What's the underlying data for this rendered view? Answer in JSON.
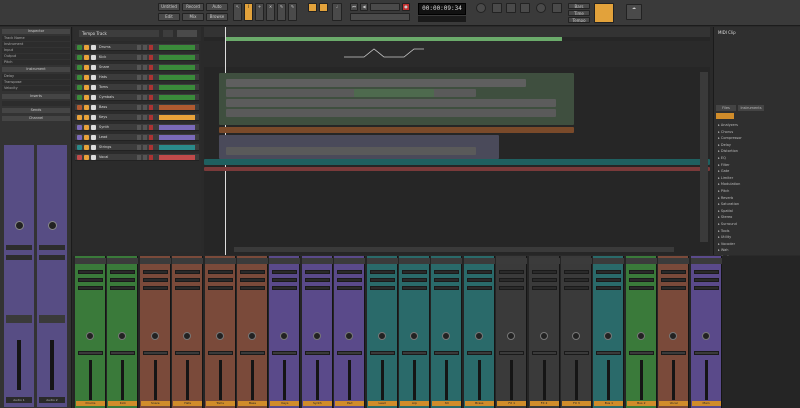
{
  "toolbar": {
    "left_buttons": [
      "Untitled",
      "Record",
      "Auto",
      "Edit",
      "Mix",
      "Browse"
    ],
    "time": "00:00:09:34",
    "right_labels": [
      "Bars",
      "Time",
      "Tempo"
    ]
  },
  "inspector": {
    "title": "Inspector",
    "rows": [
      "Track Name",
      "Instrument",
      "Input",
      "Output",
      "Pitch",
      "Delay",
      "Transpose",
      "Velocity"
    ],
    "sections": [
      "Instrument",
      "Inserts",
      "Sends",
      "Channel"
    ],
    "strips": [
      "Audio 1",
      "Audio 2"
    ]
  },
  "tracklist": {
    "header": "Tempo Track",
    "tracks": [
      {
        "name": "Drums",
        "color": "#3a8a3a"
      },
      {
        "name": "Kick",
        "color": "#3a8a3a"
      },
      {
        "name": "Snare",
        "color": "#3a8a3a"
      },
      {
        "name": "Hats",
        "color": "#3a8a3a"
      },
      {
        "name": "Toms",
        "color": "#3a8a3a"
      },
      {
        "name": "Cymbals",
        "color": "#3a8a3a"
      },
      {
        "name": "Bass",
        "color": "#b05a30"
      },
      {
        "name": "Keys",
        "color": "#e8a23a"
      },
      {
        "name": "Synth",
        "color": "#7a6ab8"
      },
      {
        "name": "Lead",
        "color": "#7a6ab8"
      },
      {
        "name": "Strings",
        "color": "#2a8a8a"
      },
      {
        "name": "Vocal",
        "color": "#c04a4a"
      }
    ]
  },
  "browser": {
    "title": "MIDI Clip",
    "tabs": [
      "Files",
      "Instruments"
    ],
    "items": [
      "Analyzers",
      "Chorus",
      "Compressor",
      "Delay",
      "Distortion",
      "EQ",
      "Filter",
      "Gate",
      "Limiter",
      "Modulation",
      "Pitch",
      "Reverb",
      "Saturation",
      "Spatial",
      "Stereo",
      "Surround",
      "Tools",
      "Utility",
      "Vocoder",
      "Wah",
      "Audio"
    ]
  },
  "mixer": {
    "strips": [
      {
        "name": "Drums",
        "color": "#3a7a3a"
      },
      {
        "name": "Kick",
        "color": "#3a7a3a"
      },
      {
        "name": "Snare",
        "color": "#7a4a3a"
      },
      {
        "name": "Hats",
        "color": "#7a4a3a"
      },
      {
        "name": "Toms",
        "color": "#7a4a3a"
      },
      {
        "name": "Bass",
        "color": "#7a4a3a"
      },
      {
        "name": "Keys",
        "color": "#5a4a8a"
      },
      {
        "name": "Synth",
        "color": "#5a4a8a"
      },
      {
        "name": "Pad",
        "color": "#5a4a8a"
      },
      {
        "name": "Lead",
        "color": "#2a6a6a"
      },
      {
        "name": "Arp",
        "color": "#2a6a6a"
      },
      {
        "name": "Str",
        "color": "#2a6a6a"
      },
      {
        "name": "Brass",
        "color": "#2a6a6a"
      },
      {
        "name": "FX 1",
        "color": "#3a3a3a"
      },
      {
        "name": "FX 2",
        "color": "#3a3a3a"
      },
      {
        "name": "FX 3",
        "color": "#3a3a3a"
      },
      {
        "name": "Bus 1",
        "color": "#2a6a6a"
      },
      {
        "name": "Bus 2",
        "color": "#3a7a3a"
      },
      {
        "name": "Vocal",
        "color": "#7a4a3a"
      },
      {
        "name": "Main",
        "color": "#5a4a8a"
      }
    ]
  }
}
